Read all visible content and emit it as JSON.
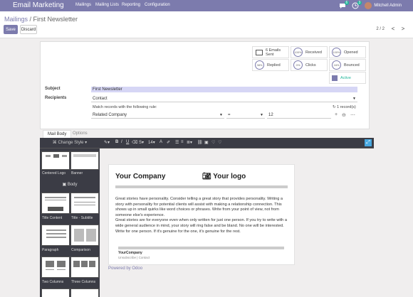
{
  "app_title": "Email Marketing",
  "nav": {
    "items": [
      "Mailings",
      "Mailing Lists",
      "Reporting",
      "Configuration"
    ]
  },
  "topright": {
    "messages_count": "6",
    "activity_count": "3",
    "user": "Mitchell Admin"
  },
  "breadcrumb": {
    "parent": "Mailings",
    "separator": " / ",
    "current": "First Newsletter"
  },
  "buttons": {
    "save": "Save",
    "discard": "Discard"
  },
  "pager": {
    "text": "2 / 2",
    "prev": "<",
    "next": ">"
  },
  "stats": {
    "emails_sent": "6 Emails Sent",
    "received": {
      "pct": "100%",
      "label": "Received"
    },
    "opened": {
      "pct": "100%",
      "label": "Opened"
    },
    "replied": {
      "pct": "38%",
      "label": "Replied"
    },
    "clicks": {
      "pct": "0%",
      "label": "Clicks"
    },
    "bounced": {
      "pct": "16%",
      "label": "Bounced"
    },
    "active": "Active"
  },
  "form": {
    "subject_label": "Subject",
    "subject_value": "First Newsletter",
    "recipients_label": "Recipients",
    "recipients_value": "Contact",
    "rule_text": "Match records with the following rule:",
    "records_count": "1 record(s)",
    "filter_field": "Related Company",
    "filter_operator": "=",
    "filter_value": "12"
  },
  "tabs": {
    "mail_body": "Mail Body",
    "options": "Options"
  },
  "snippets": {
    "change_style": "Change Style",
    "body": "Body",
    "items": [
      "Centered Logo",
      "Banner",
      "Title Content",
      "Title - Subtitle",
      "Paragraph",
      "Comparison",
      "Two Columns",
      "Three Columns"
    ]
  },
  "toolbar": {
    "font_size": "14",
    "font_letter": "A"
  },
  "email": {
    "company": "Your Company",
    "logo": "Your logo",
    "story": "Great stories have personality. Consider telling a great story that provides personality. Writing a story with personality for potential clients will assist with making a relationship connection. This shows up in small quirks like word choices or phrases. Write from your point of view, not from someone else's experience.",
    "story2": "Great stories are for everyone even when only written for just one person. If you try to write with a wide general audience in mind, your story will ring false and be bland. No one will be interested. Write for one person. If it's genuine for the one, it's genuine for the rest.",
    "footer_company": "YourCompany",
    "footer_links": "Unsubscribe | Contact"
  },
  "powered": {
    "prefix": "Powered by ",
    "brand": "Odoo"
  }
}
